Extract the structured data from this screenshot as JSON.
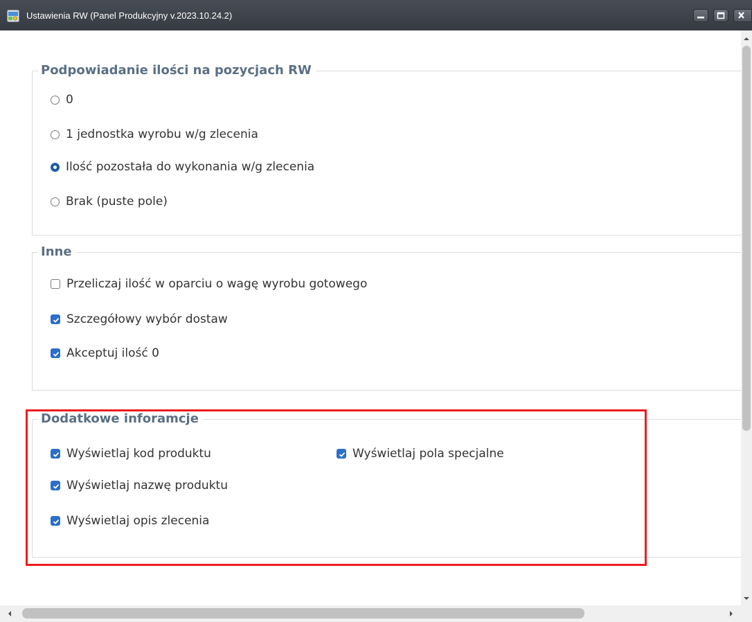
{
  "window": {
    "title": "Ustawienia RW (Panel Produkcyjny v.2023.10.24.2)",
    "icon": "app-settings-icon"
  },
  "groups": {
    "quantity_hint": {
      "legend": "Podpowiadanie ilości na pozycjach RW",
      "options": [
        {
          "label": "0",
          "checked": false
        },
        {
          "label": "1 jednostka wyrobu w/g zlecenia",
          "checked": false
        },
        {
          "label": "Ilość pozostała do wykonania w/g zlecenia",
          "checked": true
        },
        {
          "label": "Brak (puste pole)",
          "checked": false
        }
      ]
    },
    "other": {
      "legend": "Inne",
      "options": [
        {
          "label": "Przeliczaj ilość w oparciu o wagę wyrobu gotowego",
          "checked": false
        },
        {
          "label": "Szczegółowy wybór dostaw",
          "checked": true
        },
        {
          "label": "Akceptuj ilość 0",
          "checked": true
        }
      ]
    },
    "additional_info": {
      "legend": "Dodatkowe inforamcje",
      "options": [
        {
          "label": "Wyświetlaj kod produktu",
          "checked": true
        },
        {
          "label": "Wyświetlaj nazwę produktu",
          "checked": true
        },
        {
          "label": "Wyświetlaj opis zlecenia",
          "checked": true
        },
        {
          "label": "Wyświetlaj pola specjalne",
          "checked": true
        }
      ]
    }
  },
  "colors": {
    "accent": "#2a6fc9",
    "legend": "#5a6f84",
    "highlight": "#ee1c1c",
    "titlebar": "#3d434b"
  }
}
